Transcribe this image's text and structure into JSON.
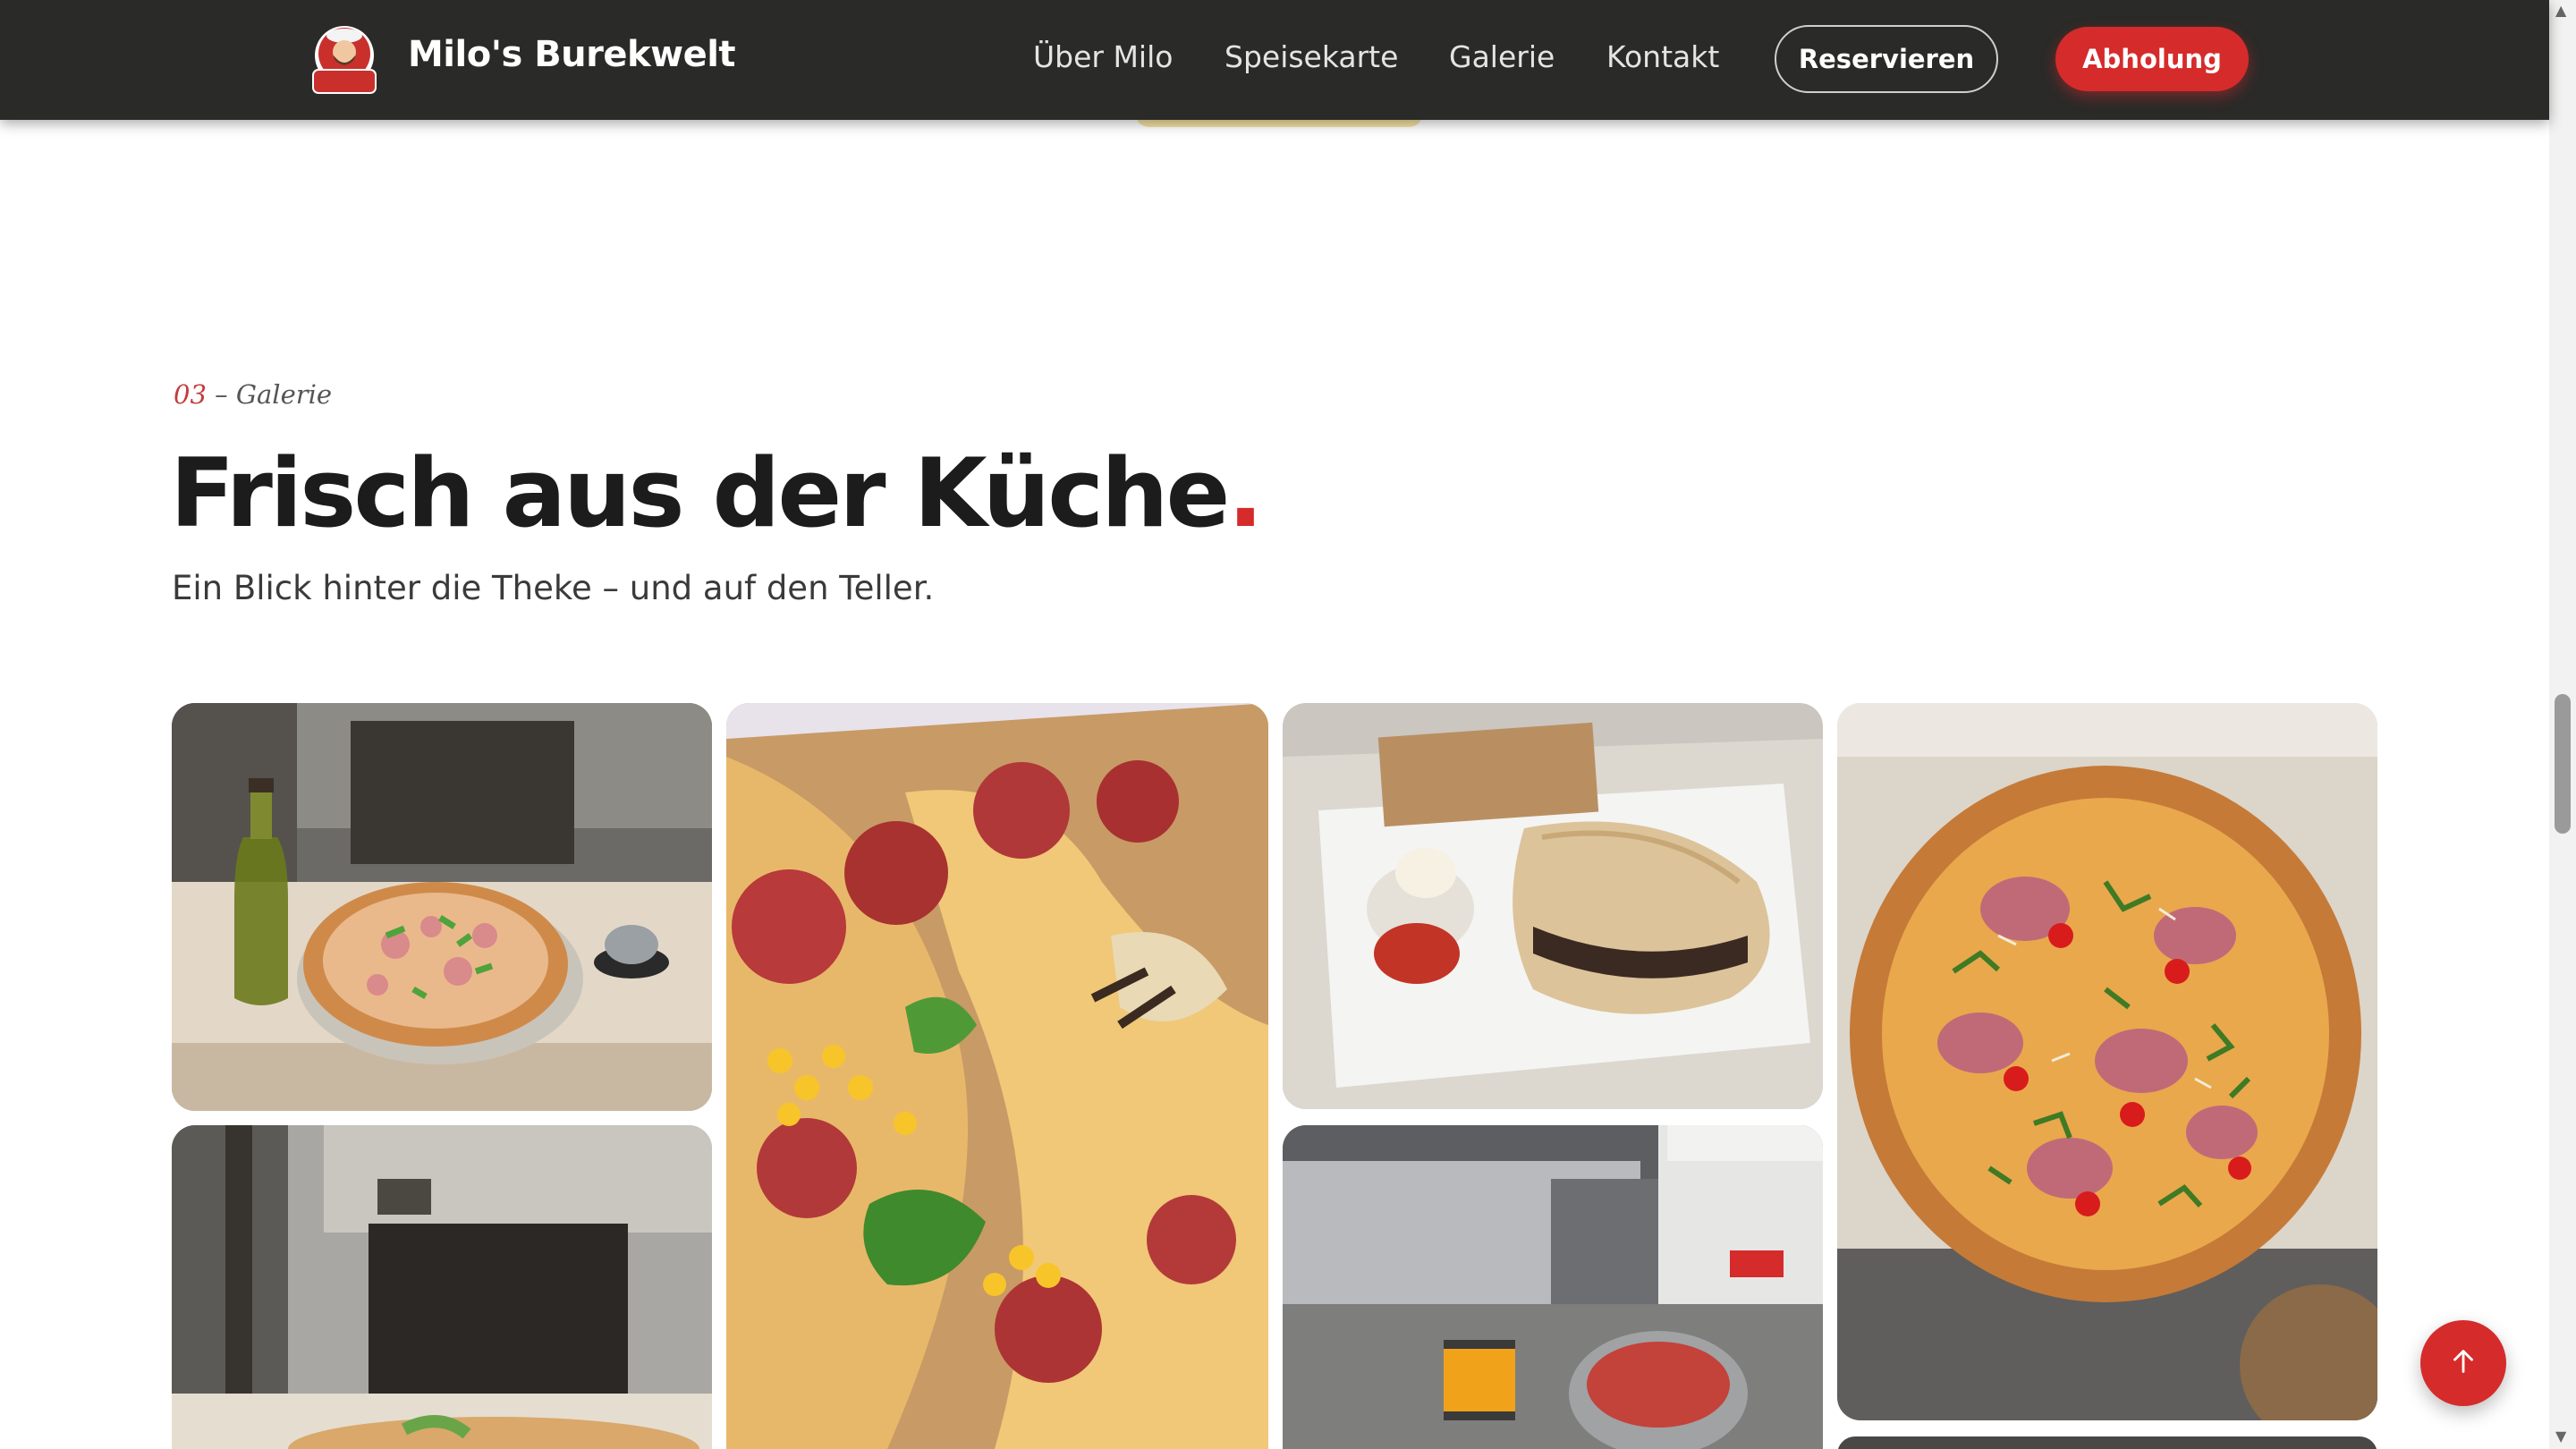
{
  "header": {
    "brand": "Milo's Burekwelt",
    "logo_text": "Milo's Burekwelt",
    "nav": [
      "Über Milo",
      "Speisekarte",
      "Galerie",
      "Kontakt"
    ],
    "reserve_label": "Reservieren",
    "pickup_label": "Abholung"
  },
  "section": {
    "eyebrow_num": "03",
    "eyebrow_sep": " – ",
    "eyebrow_label": "Galerie",
    "title": "Frisch aus der Küche",
    "title_dot": ".",
    "subtitle": "Ein Blick hinter die Theke – und auf den Teller."
  },
  "gallery": {
    "items": [
      {
        "subject": "pizza-with-olive-oil-photo"
      },
      {
        "subject": "salami-corn-pizza-closeup-photo"
      },
      {
        "subject": "burek-plate-with-dips-photo"
      },
      {
        "subject": "prosciutto-rucola-pizza-photo"
      },
      {
        "subject": "counter-with-plate-photo"
      },
      {
        "subject": "kitchen-prep-station-photo"
      }
    ]
  },
  "colors": {
    "header_bg": "#2a2a28",
    "accent": "#d62b2b",
    "text": "#1c1c1c"
  },
  "icons": {
    "back_to_top": "arrow-up-icon"
  }
}
